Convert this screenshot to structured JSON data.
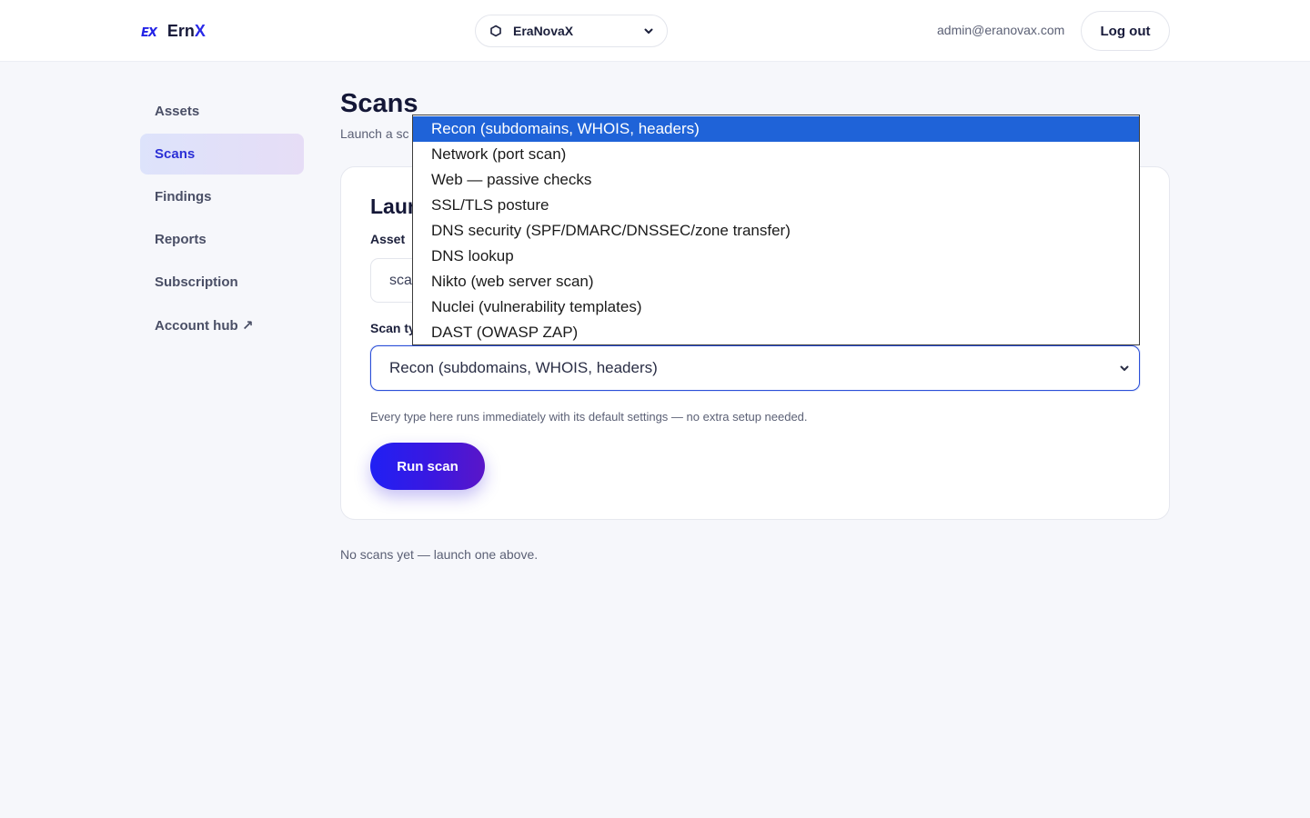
{
  "header": {
    "logo_mark": "EX",
    "brand_prefix": "Ern",
    "brand_suffix": "X",
    "org_selector": {
      "value": "EraNovaX",
      "icon": "hexagon-icon"
    },
    "user_email": "admin@eranovax.com",
    "logout_label": "Log out"
  },
  "sidebar": {
    "items": [
      {
        "label": "Assets"
      },
      {
        "label": "Scans",
        "active": true
      },
      {
        "label": "Findings"
      },
      {
        "label": "Reports"
      },
      {
        "label": "Subscription"
      },
      {
        "label": "Account hub ↗"
      }
    ]
  },
  "main": {
    "title": "Scans",
    "subtitle": "Launch a sc",
    "empty_note": "No scans yet — launch one above."
  },
  "launch_card": {
    "title": "Laun",
    "asset_label": "Asset",
    "asset_value": "sca",
    "scan_type_label": "Scan ty",
    "scan_type_selected": "Recon (subdomains, WHOIS, headers)",
    "help_text": "Every type here runs immediately with its default settings — no extra setup needed.",
    "run_label": "Run scan"
  },
  "scan_type_options": [
    "Recon (subdomains, WHOIS, headers)",
    "Network (port scan)",
    "Web — passive checks",
    "SSL/TLS posture",
    "DNS security (SPF/DMARC/DNSSEC/zone transfer)",
    "DNS lookup",
    "Nikto (web server scan)",
    "Nuclei (vulnerability templates)",
    "DAST (OWASP ZAP)"
  ],
  "colors": {
    "accent": "#2b2fd6",
    "button_gradient_start": "#2020f4",
    "button_gradient_end": "#5a16c8",
    "dropdown_highlight": "#1f63d8",
    "page_background": "#f6f7fb"
  }
}
